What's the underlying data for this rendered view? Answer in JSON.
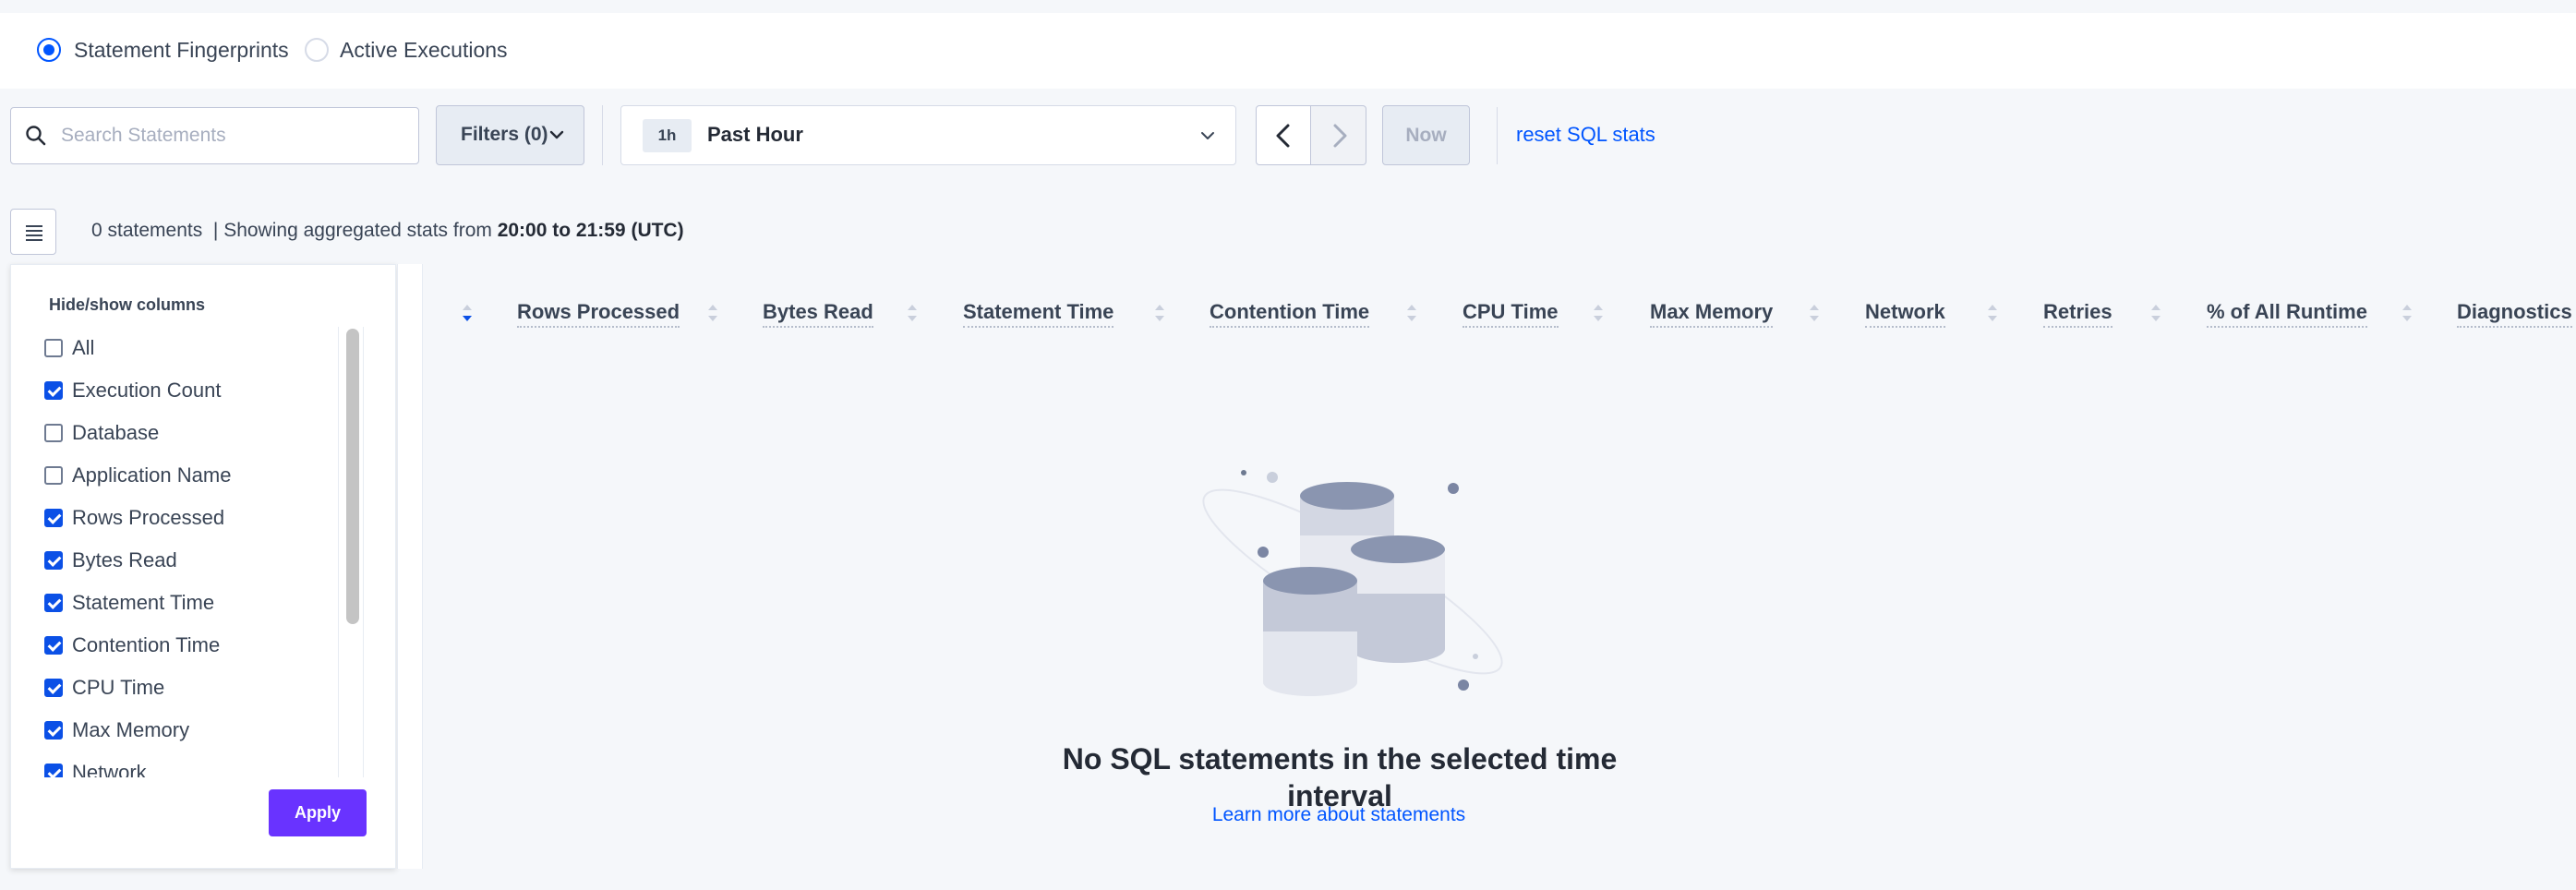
{
  "view_toggle": {
    "options": [
      {
        "label": "Statement Fingerprints",
        "selected": true
      },
      {
        "label": "Active Executions",
        "selected": false
      }
    ]
  },
  "toolbar": {
    "search_placeholder": "Search Statements",
    "filters_label": "Filters (0)",
    "time_badge": "1h",
    "time_label": "Past Hour",
    "now_label": "Now",
    "reset_label": "reset SQL stats"
  },
  "summary": {
    "count": "0 statements",
    "prefix": "|  Showing aggregated stats from ",
    "range": "20:00 to 21:59 (UTC)"
  },
  "column_picker": {
    "title": "Hide/show columns",
    "items": [
      {
        "label": "All",
        "checked": false
      },
      {
        "label": "Execution Count",
        "checked": true
      },
      {
        "label": "Database",
        "checked": false
      },
      {
        "label": "Application Name",
        "checked": false
      },
      {
        "label": "Rows Processed",
        "checked": true
      },
      {
        "label": "Bytes Read",
        "checked": true
      },
      {
        "label": "Statement Time",
        "checked": true
      },
      {
        "label": "Contention Time",
        "checked": true
      },
      {
        "label": "CPU Time",
        "checked": true
      },
      {
        "label": "Max Memory",
        "checked": true
      },
      {
        "label": "Network",
        "checked": true
      }
    ],
    "apply_label": "Apply"
  },
  "table": {
    "headers": [
      "Rows Processed",
      "Bytes Read",
      "Statement Time",
      "Contention Time",
      "CPU Time",
      "Max Memory",
      "Network",
      "Retries",
      "% of All Runtime",
      "Diagnostics"
    ]
  },
  "empty_state": {
    "title": "No SQL statements in the selected time interval",
    "link": "Learn more about statements"
  },
  "colors": {
    "accent": "#0055ff",
    "apply": "#6933ff",
    "checkbox": "#0b50e6"
  }
}
